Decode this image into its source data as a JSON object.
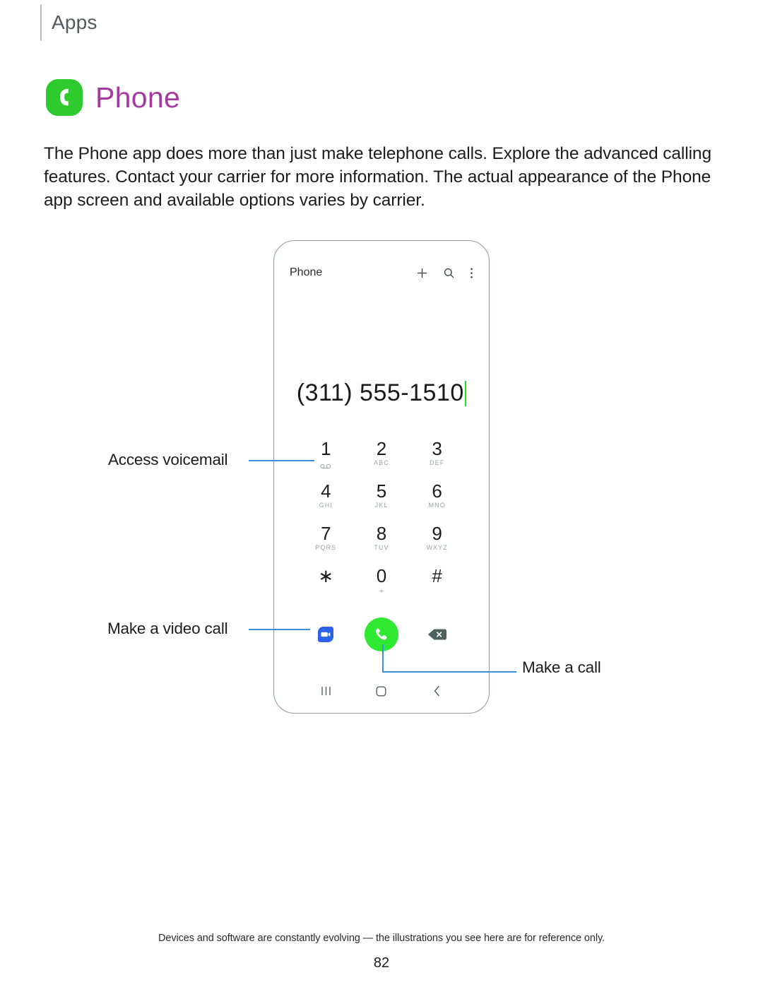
{
  "running_head": {
    "label": "Apps"
  },
  "app": {
    "icon_name": "phone-app-icon",
    "icon_color": "#2ecb2e",
    "title": "Phone",
    "title_color": "#a6399f"
  },
  "intro": {
    "text": "The Phone app does more than just make telephone calls. Explore the advanced calling features. Contact your carrier for more information. The actual appearance of the Phone app screen and available options varies by carrier."
  },
  "phone_mock": {
    "app_bar": {
      "title": "Phone",
      "icons": [
        {
          "name": "add-icon",
          "glyph": "plus"
        },
        {
          "name": "search-icon",
          "glyph": "magnifier"
        },
        {
          "name": "more-options-icon",
          "glyph": "three-dots-vertical"
        }
      ]
    },
    "dialer": {
      "number": "(311) 555-1510",
      "caret_color": "#24e024"
    },
    "keypad": [
      {
        "digit": "1",
        "sub": "",
        "sub_icon": "voicemail-icon"
      },
      {
        "digit": "2",
        "sub": "ABC",
        "sub_icon": ""
      },
      {
        "digit": "3",
        "sub": "DEF",
        "sub_icon": ""
      },
      {
        "digit": "4",
        "sub": "GHI",
        "sub_icon": ""
      },
      {
        "digit": "5",
        "sub": "JKL",
        "sub_icon": ""
      },
      {
        "digit": "6",
        "sub": "MNO",
        "sub_icon": ""
      },
      {
        "digit": "7",
        "sub": "PQRS",
        "sub_icon": ""
      },
      {
        "digit": "8",
        "sub": "TUV",
        "sub_icon": ""
      },
      {
        "digit": "9",
        "sub": "WXYZ",
        "sub_icon": ""
      },
      {
        "digit": "∗",
        "sub": "",
        "sub_icon": ""
      },
      {
        "digit": "0",
        "sub": "+",
        "sub_icon": ""
      },
      {
        "digit": "#",
        "sub": "",
        "sub_icon": ""
      }
    ],
    "actions": [
      {
        "name": "video-call-button",
        "icon": "duo-video-icon",
        "color": "#2d62e8"
      },
      {
        "name": "call-button",
        "icon": "phone-handset-icon",
        "color": "#2ee832"
      },
      {
        "name": "backspace-button",
        "icon": "backspace-icon",
        "color": "#4e6360"
      }
    ],
    "nav_bar": [
      {
        "name": "recents-button",
        "icon": "recents-icon"
      },
      {
        "name": "home-button",
        "icon": "home-square-icon"
      },
      {
        "name": "back-button",
        "icon": "back-chevron-icon"
      }
    ]
  },
  "callouts": {
    "voicemail": "Access voicemail",
    "video_call": "Make a video call",
    "make_call": "Make a call",
    "leader_color": "#3a8fe0"
  },
  "footer": {
    "note": "Devices and software are constantly evolving — the illustrations you see here are for reference only.",
    "page_number": "82"
  }
}
